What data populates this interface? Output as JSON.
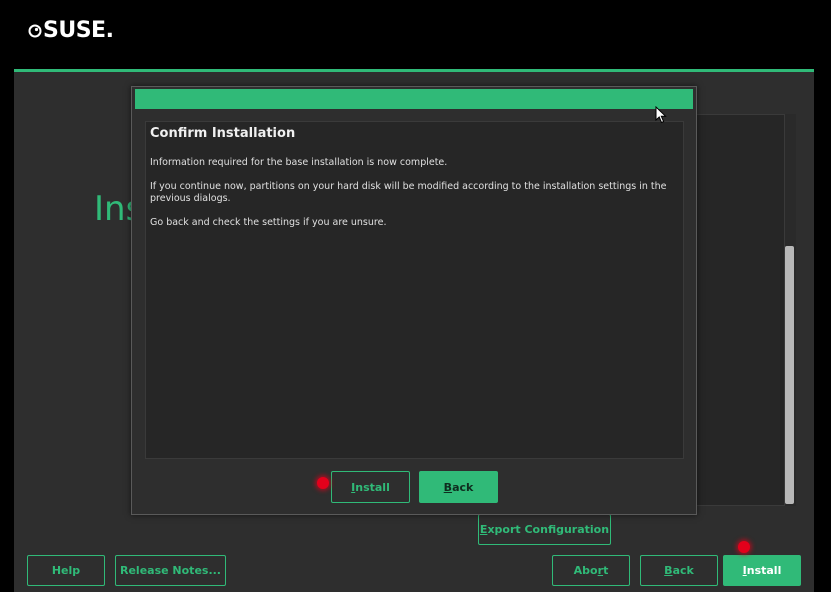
{
  "brand": {
    "name": "SUSE",
    "suffix": "."
  },
  "page": {
    "heading_fragment": "Ins"
  },
  "dialog": {
    "title": "Confirm Installation",
    "paragraphs": [
      "Information required for the base installation is now complete.",
      "If you continue now, partitions on your hard disk will be modified according to the installation settings in the previous dialogs.",
      "Go back and check the settings if you are unsure."
    ],
    "buttons": {
      "install": {
        "pre": "",
        "u": "I",
        "post": "nstall"
      },
      "back": {
        "pre": "",
        "u": "B",
        "post": "ack"
      }
    }
  },
  "main_buttons": {
    "export": {
      "pre": "",
      "u": "E",
      "post": "xport Configuration"
    },
    "help": "Help",
    "release_notes": "Release Notes...",
    "abort": {
      "pre": "Abo",
      "u": "r",
      "post": "t"
    },
    "back": {
      "pre": "",
      "u": "B",
      "post": "ack"
    },
    "install": {
      "pre": "",
      "u": "I",
      "post": "nstall"
    }
  },
  "colors": {
    "accent": "#30ba78",
    "background": "#2e2e2e",
    "click_marker": "#e3001b"
  },
  "icons": {
    "logo": "suse-chameleon-icon",
    "cursor": "mouse-pointer-icon"
  }
}
